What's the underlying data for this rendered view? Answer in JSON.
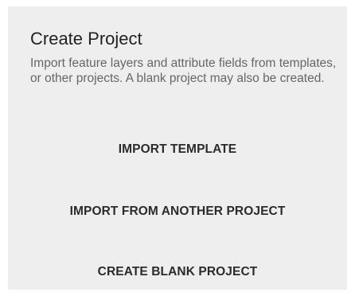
{
  "dialog": {
    "title": "Create Project",
    "description": "Import feature layers and attribute fields from templates, or other projects. A blank project may also be created.",
    "actions": [
      {
        "label": "IMPORT TEMPLATE"
      },
      {
        "label": "IMPORT FROM ANOTHER PROJECT"
      },
      {
        "label": "CREATE BLANK PROJECT"
      }
    ]
  }
}
